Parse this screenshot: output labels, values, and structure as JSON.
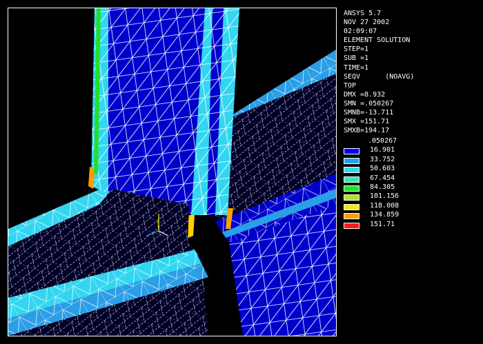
{
  "info": {
    "lines": [
      "ANSYS 5.7",
      "NOV 27 2002",
      "02:09:07",
      "ELEMENT SOLUTION",
      "STEP=1",
      "SUB =1",
      "TIME=1",
      "SEQV      (NOAVG)",
      "TOP",
      "DMX =8.932",
      "SMN =.050267",
      "SMNB=-13.711",
      "SMX =151.71",
      "SMXB=194.17"
    ]
  },
  "legend": {
    "title": ".050267",
    "entries": [
      {
        "label": "16.901",
        "color": "#0000ff"
      },
      {
        "label": "33.752",
        "color": "#2a9ee6"
      },
      {
        "label": "50.603",
        "color": "#33d6f0"
      },
      {
        "label": "67.454",
        "color": "#2ee8b8"
      },
      {
        "label": "84.305",
        "color": "#22e02a"
      },
      {
        "label": "101.156",
        "color": "#a8e81a"
      },
      {
        "label": "118.008",
        "color": "#f6e800"
      },
      {
        "label": "134.859",
        "color": "#ff9d00"
      },
      {
        "label": "151.71",
        "color": "#ff1a1a"
      }
    ]
  },
  "colors": {
    "background": "#000000",
    "mesh": "#ffffff",
    "low_stress": "#0000cc",
    "mid_stress": "#33d6f0"
  }
}
